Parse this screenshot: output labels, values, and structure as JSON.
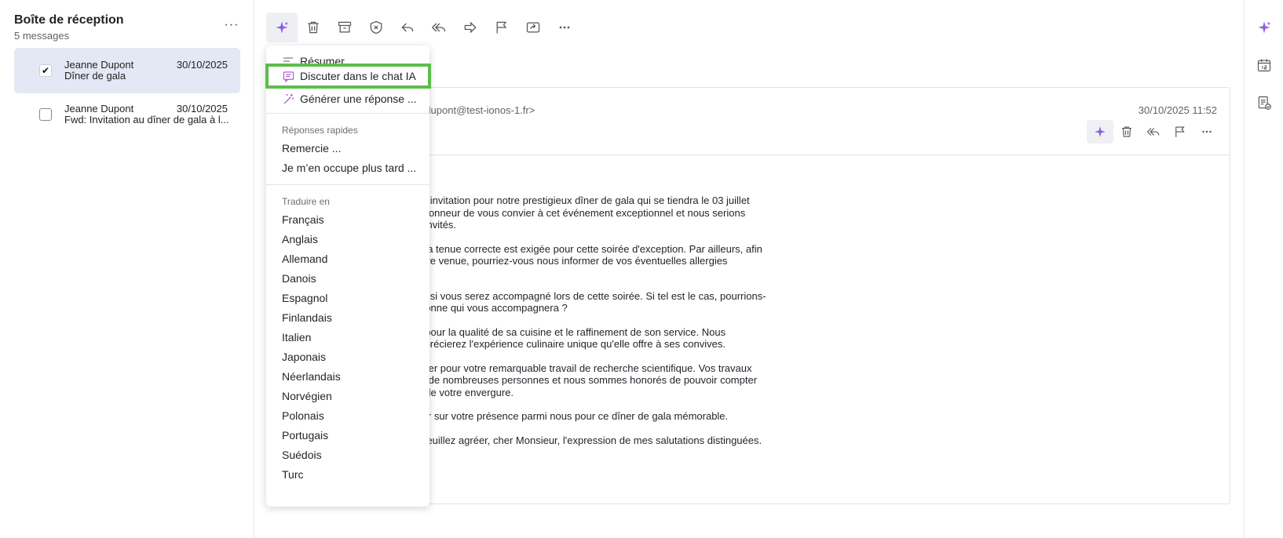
{
  "inbox": {
    "title": "Boîte de réception",
    "count": "5 messages",
    "more": "···",
    "messages": [
      {
        "sender": "Jeanne Dupont",
        "subject": "Dîner de gala",
        "date": "30/10/2025",
        "checked": "✔"
      },
      {
        "sender": "Jeanne Dupont",
        "subject": "Fwd: Invitation au dîner de gala à l...",
        "date": "30/10/2025",
        "checked": ""
      }
    ]
  },
  "toolbar": {
    "buttons": [
      "ai-sparkle-icon",
      "trash-icon",
      "archive-icon",
      "spam-icon",
      "reply-icon",
      "reply-all-icon",
      "forward-icon",
      "flag-icon",
      "move-folder-icon",
      "more-icon"
    ]
  },
  "menu": {
    "items": {
      "summarize": "Résumer",
      "chat": "Discuter dans le chat IA",
      "generate": "Générer une réponse ..."
    },
    "quick_label": "Réponses rapides",
    "quick": [
      "Remercie ...",
      "Je m’en occupe plus tard ..."
    ],
    "translate_label": "Traduire en",
    "languages": [
      "Français",
      "Anglais",
      "Allemand",
      "Danois",
      "Espagnol",
      "Finlandais",
      "Italien",
      "Japonais",
      "Néerlandais",
      "Norvégien",
      "Polonais",
      "Portugais",
      "Suédois",
      "Turc"
    ]
  },
  "email": {
    "from": "nne.dupont@test-ionos-1.fr>",
    "datetime": "30/10/2025 11:52",
    "body": [
      "cette invitation pour notre prestigieux dîner de gala qui se tiendra le 03 juillet",
      "ns l'honneur de vous convier à cet événement exceptionnel et nous serions",
      "nos invités.",
      "que la tenue correcte est exigée pour cette soirée d'exception. Par ailleurs, afin",
      "x votre venue, pourriez-vous nous informer de vos éventuelles allergies",
      "avoir si vous serez accompagné lors de cette soirée. Si tel est le cas, pourrions-",
      "personne qui vous accompagnera ?",
      "née pour la qualité de sa cuisine et le raffinement de son service. Nous",
      "s apprécierez l'expérience culinaire unique qu'elle offre à ses convives.",
      "féliciter pour votre remarquable travail de recherche scientifique. Vos travaux",
      "pour de nombreuses personnes et nous sommes honorés de pouvoir compter",
      "que de votre envergure.",
      "mpter sur votre présence parmi nous pour ce dîner de gala mémorable.",
      "se, veuillez agréer, cher Monsieur, l'expression de mes salutations distinguées."
    ]
  },
  "colors": {
    "accent": "#8a4fd8",
    "highlight_border": "#5cbd4a",
    "selected_row": "#e4e8f5"
  }
}
